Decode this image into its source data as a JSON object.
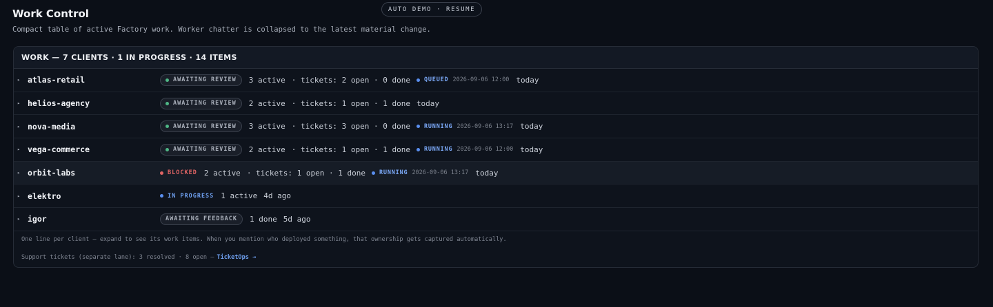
{
  "demo_button": "AUTO DEMO · RESUME",
  "page": {
    "title": "Work Control",
    "subtitle": "Compact table of active Factory work. Worker chatter is collapsed to the latest material change."
  },
  "panel": {
    "header": "WORK — 7 CLIENTS · 1 IN PROGRESS · 14 ITEMS"
  },
  "rows": [
    {
      "client": "atlas-retail",
      "status": "AWAITING REVIEW",
      "active": "3 active",
      "tickets": "· tickets: 2 open · 0 done",
      "run_status": "QUEUED",
      "run_time": "2026-09-06 12:00",
      "when": "today"
    },
    {
      "client": "helios-agency",
      "status": "AWAITING REVIEW",
      "active": "2 active",
      "tickets": "· tickets: 1 open · 1 done",
      "when": "today"
    },
    {
      "client": "nova-media",
      "status": "AWAITING REVIEW",
      "active": "3 active",
      "tickets": "· tickets: 3 open · 0 done",
      "run_status": "RUNNING",
      "run_time": "2026-09-06 13:17",
      "when": "today"
    },
    {
      "client": "vega-commerce",
      "status": "AWAITING REVIEW",
      "active": "2 active",
      "tickets": "· tickets: 1 open · 1 done",
      "run_status": "RUNNING",
      "run_time": "2026-09-06 12:00",
      "when": "today"
    },
    {
      "client": "orbit-labs",
      "status": "BLOCKED",
      "active": "2 active",
      "tickets": "· tickets: 1 open · 1 done",
      "run_status": "RUNNING",
      "run_time": "2026-09-06 13:17",
      "when": "today"
    },
    {
      "client": "elektro",
      "status": "IN PROGRESS",
      "active": "1 active",
      "when": "4d ago"
    },
    {
      "client": "igor",
      "status": "AWAITING FEEDBACK",
      "done": "1 done",
      "when": "5d ago"
    }
  ],
  "footnote": "One line per client — expand to see its work items. When you mention who deployed something, that ownership gets captured automatically.",
  "support": {
    "text": "Support tickets (separate lane): 3 resolved · 8 open —",
    "link": "TicketOps →"
  },
  "colors": {
    "background": "#0b0f17",
    "review_dot": "#4fb786",
    "blocked": "#e06464",
    "running": "#5a8ff0"
  }
}
